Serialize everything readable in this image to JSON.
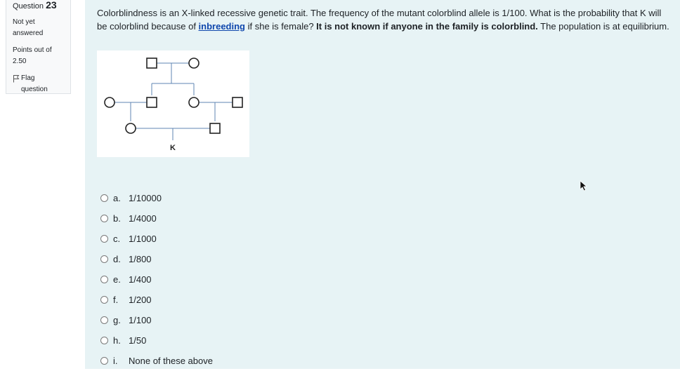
{
  "question": {
    "label": "Question",
    "number": "23",
    "state": "Not yet answered",
    "state_line1": "Not yet",
    "state_line2": "answered",
    "points_label": "Points out of",
    "points": "2.50",
    "flag_line1": "Flag",
    "flag_line2": "question",
    "text_part1": "Colorblindness is an X-linked recessive genetic trait.  The frequency of the mutant colorblind allele is 1/100.  What is the probability that K will be colorblind because of ",
    "text_link": "inbreeding",
    "text_part2": " if she is female?  ",
    "text_bold": "It is not known if anyone in the family is colorblind.",
    "text_part3": "  The population is at equilibrium."
  },
  "pedigree": {
    "label_k": "K"
  },
  "answers": [
    {
      "letter": "a.",
      "text": "1/10000"
    },
    {
      "letter": "b.",
      "text": "1/4000"
    },
    {
      "letter": "c.",
      "text": "1/1000"
    },
    {
      "letter": "d.",
      "text": "1/800"
    },
    {
      "letter": "e.",
      "text": "1/400"
    },
    {
      "letter": "f.",
      "text": "1/200"
    },
    {
      "letter": "g.",
      "text": "1/100"
    },
    {
      "letter": "h.",
      "text": "1/50"
    },
    {
      "letter": "i.",
      "text": "None of these above"
    }
  ],
  "icons": {
    "flag": "flag-icon",
    "cursor": "mouse-pointer-icon"
  }
}
